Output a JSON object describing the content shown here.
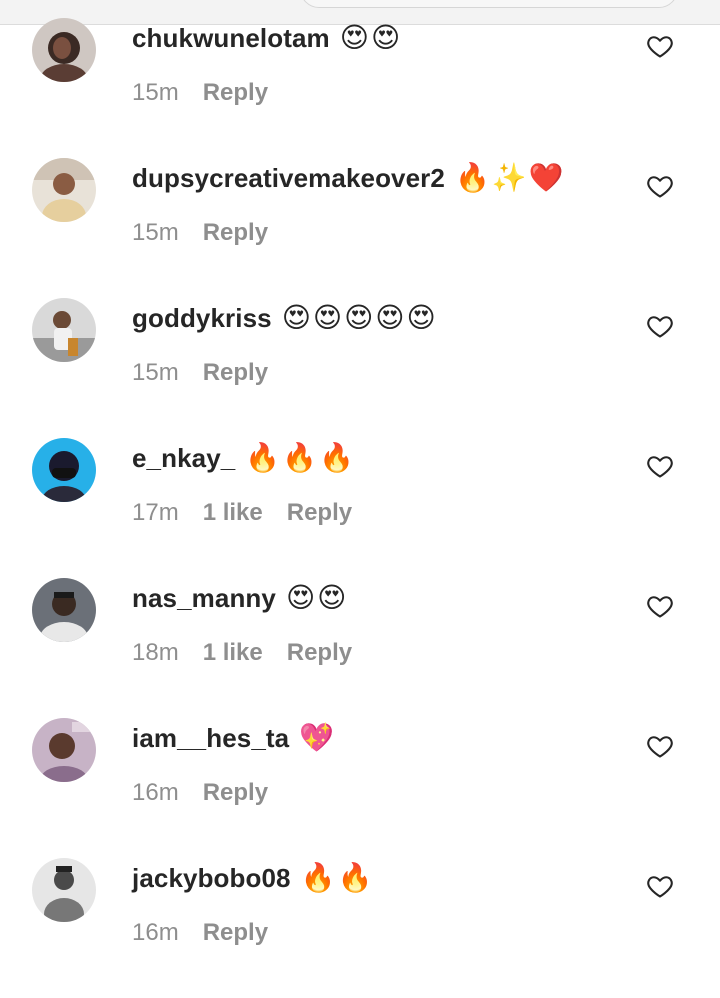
{
  "comments": [
    {
      "username": "chukwunelotam",
      "emojis": "😍😍",
      "time": "15m",
      "likes": "",
      "reply": "Reply",
      "avatar_icon": "profile-photo",
      "avatar_color": "#3b2a24"
    },
    {
      "username": "dupsycreativemakeover2",
      "emojis": "🔥✨❤️",
      "time": "15m",
      "likes": "",
      "reply": "Reply",
      "avatar_icon": "profile-photo",
      "avatar_color": "#c9b08a"
    },
    {
      "username": "goddykriss",
      "emojis": "😍😍😍😍😍",
      "time": "15m",
      "likes": "",
      "reply": "Reply",
      "avatar_icon": "profile-photo",
      "avatar_color": "#9a9a9a"
    },
    {
      "username": "e_nkay_",
      "emojis": "🔥🔥🔥",
      "time": "17m",
      "likes": "1 like",
      "reply": "Reply",
      "avatar_icon": "profile-photo",
      "avatar_color": "#22a7e0"
    },
    {
      "username": "nas_manny",
      "emojis": "😍😍",
      "time": "18m",
      "likes": "1 like",
      "reply": "Reply",
      "avatar_icon": "profile-photo",
      "avatar_color": "#5a5f66"
    },
    {
      "username": "iam__hes_ta",
      "emojis": "💖",
      "time": "16m",
      "likes": "",
      "reply": "Reply",
      "avatar_icon": "profile-photo",
      "avatar_color": "#b79bb8"
    },
    {
      "username": "jackybobo08",
      "emojis": "🔥🔥",
      "time": "16m",
      "likes": "",
      "reply": "Reply",
      "avatar_icon": "profile-photo",
      "avatar_color": "#8c8c8c"
    }
  ],
  "icons": {
    "like": "heart-outline-icon"
  },
  "colors": {
    "text_primary": "#262626",
    "text_secondary": "#8e8e8e",
    "background": "#ffffff"
  }
}
